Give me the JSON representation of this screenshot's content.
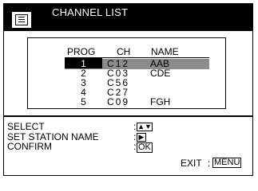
{
  "header": {
    "title": "CHANNEL LIST",
    "menu_icon": "list-menu-icon"
  },
  "channel_list": {
    "columns": {
      "prog": "PROG",
      "ch": "CH",
      "name": "NAME"
    },
    "selected_index": 0,
    "rows": [
      {
        "prog": "1",
        "ch": "C12",
        "name": "AAB"
      },
      {
        "prog": "2",
        "ch": "C03",
        "name": "CDE"
      },
      {
        "prog": "3",
        "ch": "C56",
        "name": ""
      },
      {
        "prog": "4",
        "ch": "C27",
        "name": ""
      },
      {
        "prog": "5",
        "ch": "C09",
        "name": "FGH"
      }
    ]
  },
  "help": {
    "select_label": "SELECT",
    "select_key": "▲▼",
    "set_station_label": "SET STATION NAME",
    "set_station_key": "▶",
    "confirm_label": "CONFIRM",
    "confirm_key": "OK",
    "exit_label": "EXIT",
    "exit_key": "MENU",
    "separator": ":"
  }
}
